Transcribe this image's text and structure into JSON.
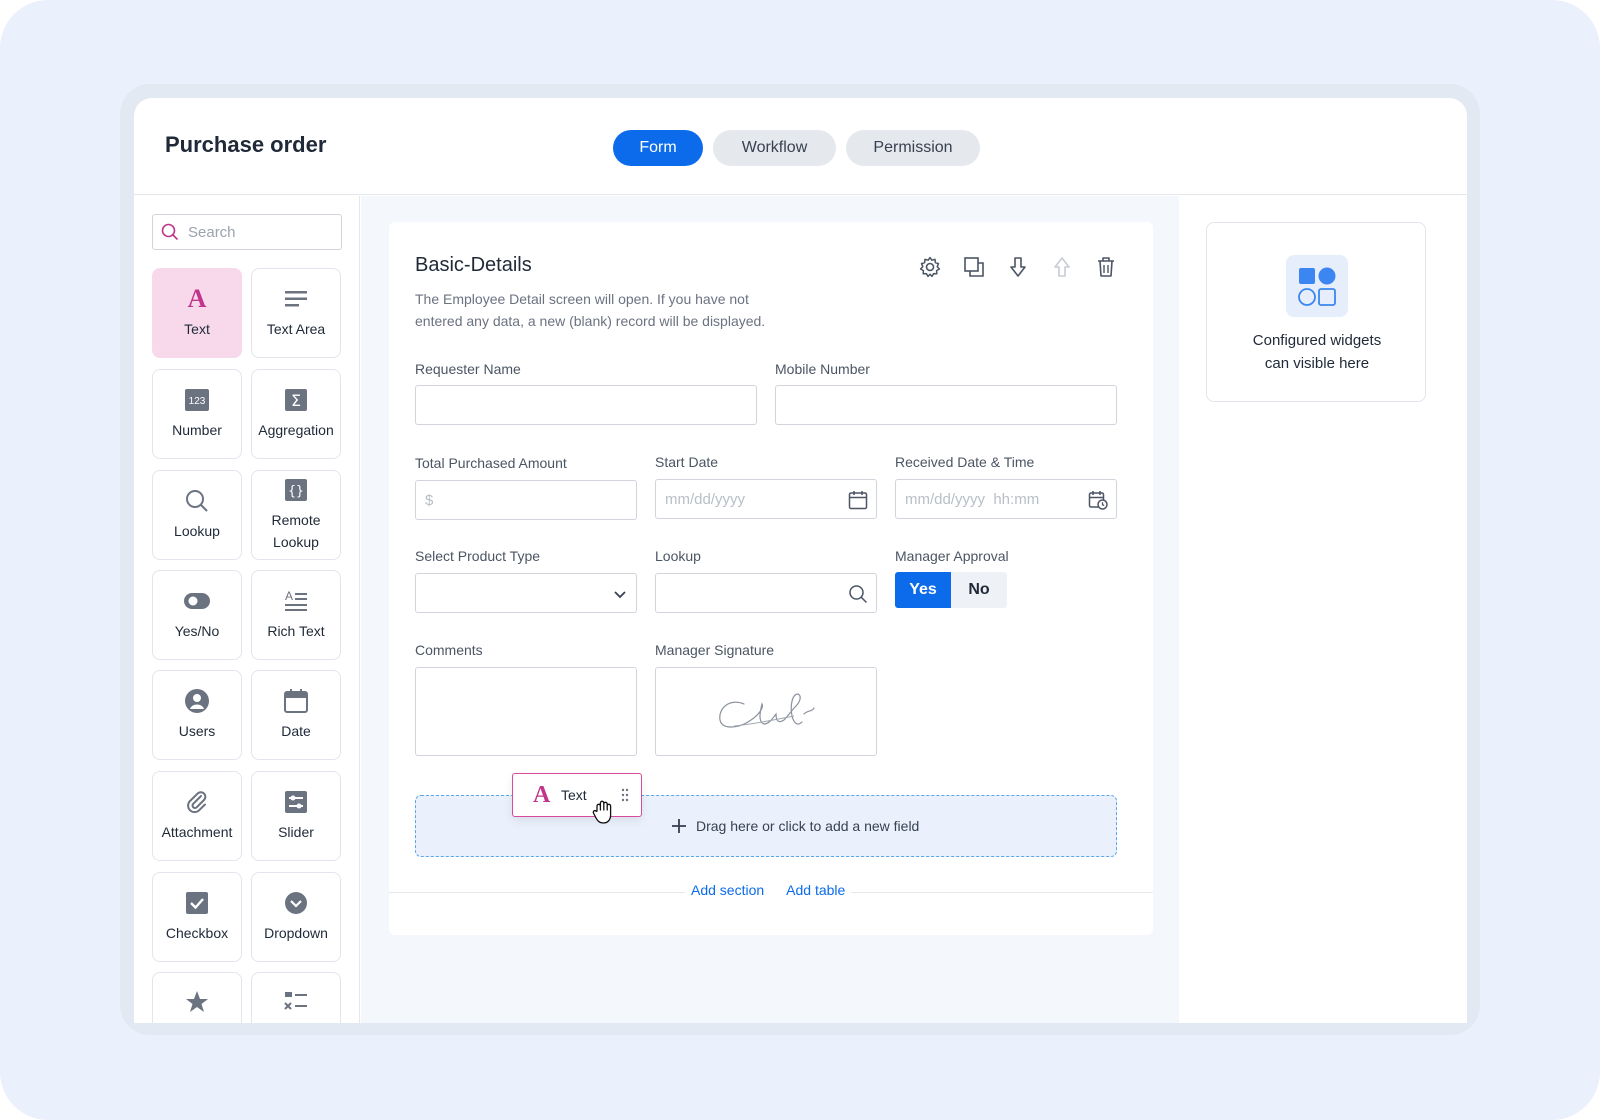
{
  "app": {
    "title": "Purchase order",
    "tabs": [
      {
        "label": "Form",
        "active": true
      },
      {
        "label": "Workflow",
        "active": false
      },
      {
        "label": "Permission",
        "active": false
      }
    ]
  },
  "sidebar": {
    "search_placeholder": "Search",
    "widgets": [
      {
        "label": "Text",
        "icon": "text-a-icon",
        "active": true
      },
      {
        "label": "Text Area",
        "icon": "text-area-icon"
      },
      {
        "label": "Number",
        "icon": "number-123-icon"
      },
      {
        "label": "Aggregation",
        "icon": "sigma-icon"
      },
      {
        "label": "Lookup",
        "icon": "search-icon"
      },
      {
        "label": "Remote Lookup",
        "icon": "braces-icon"
      },
      {
        "label": "Yes/No",
        "icon": "toggle-icon"
      },
      {
        "label": "Rich Text",
        "icon": "rich-text-icon"
      },
      {
        "label": "Users",
        "icon": "user-icon"
      },
      {
        "label": "Date",
        "icon": "calendar-icon"
      },
      {
        "label": "Attachment",
        "icon": "paperclip-icon"
      },
      {
        "label": "Slider",
        "icon": "slider-icon"
      },
      {
        "label": "Checkbox",
        "icon": "checkbox-icon"
      },
      {
        "label": "Dropdown",
        "icon": "dropdown-icon"
      },
      {
        "label": "",
        "icon": "star-icon"
      },
      {
        "label": "",
        "icon": "checklist-icon"
      }
    ]
  },
  "section": {
    "title": "Basic-Details",
    "description": "The Employee Detail screen will open. If you have not entered any data, a new (blank) record will be displayed.",
    "fields": {
      "requester_name": {
        "label": "Requester Name",
        "value": ""
      },
      "mobile_number": {
        "label": "Mobile Number",
        "value": ""
      },
      "total_amount": {
        "label": "Total Purchased Amount",
        "placeholder": "$"
      },
      "start_date": {
        "label": "Start Date",
        "placeholder": "mm/dd/yyyy"
      },
      "received_date": {
        "label": "Received Date & Time",
        "placeholder": "mm/dd/yyyy  hh:mm"
      },
      "product_type": {
        "label": "Select Product Type",
        "value": ""
      },
      "lookup": {
        "label": "Lookup",
        "value": ""
      },
      "manager_approval": {
        "label": "Manager Approval",
        "yes": "Yes",
        "no": "No",
        "selected": "Yes"
      },
      "comments": {
        "label": "Comments",
        "value": ""
      },
      "manager_signature": {
        "label": "Manager Signature"
      }
    },
    "dropzone_text": "Drag here or click to add a new field",
    "add_section": "Add section",
    "add_table": "Add table"
  },
  "drag_chip": {
    "label": "Text"
  },
  "right_panel": {
    "line1": "Configured widgets",
    "line2": "can visible here"
  },
  "colors": {
    "accent": "#0b6bea",
    "text_widget_active_bg": "#f8d9ec",
    "text_widget_accent": "#c0368a",
    "page_background": "#ebf1fc"
  }
}
